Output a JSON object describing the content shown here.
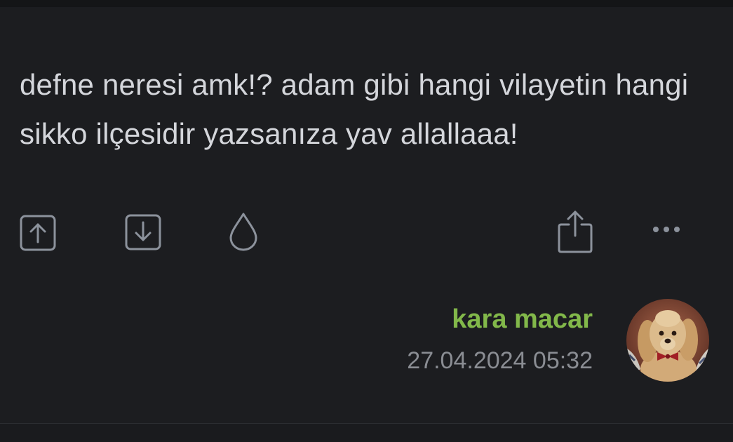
{
  "entry": {
    "text": "defne neresi amk!? adam gibi hangi vilayetin hangi sikko ilçesidir yazsanıza yav allallaaa!"
  },
  "actions": [
    {
      "name": "upvote",
      "icon": "arrow-up-square-icon"
    },
    {
      "name": "downvote",
      "icon": "arrow-down-square-icon"
    },
    {
      "name": "drop",
      "icon": "droplet-icon"
    },
    {
      "name": "share",
      "icon": "share-icon"
    },
    {
      "name": "more",
      "icon": "more-dots-icon"
    }
  ],
  "author": {
    "name": "kara macar",
    "date": "27.04.2024 05:32",
    "avatar_icon": "dog-avatar"
  },
  "colors": {
    "background": "#1c1d20",
    "text": "#d4d6db",
    "icon": "#8c929c",
    "author": "#82b84a",
    "date": "#8a8d93"
  }
}
